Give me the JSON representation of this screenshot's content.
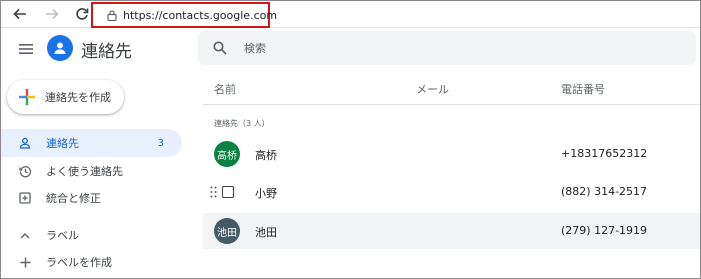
{
  "browser": {
    "url": "https://contacts.google.com",
    "icons": [
      "back-arrow-icon",
      "forward-arrow-icon",
      "reload-icon",
      "lock-icon"
    ]
  },
  "app": {
    "title": "連絡先",
    "search_placeholder": "検索",
    "create_label": "連絡先を作成"
  },
  "sidebar": {
    "items": [
      {
        "label": "連絡先",
        "icon": "person-icon",
        "count": "3",
        "active": true
      },
      {
        "label": "よく使う連絡先",
        "icon": "history-icon"
      },
      {
        "label": "統合と修正",
        "icon": "merge-icon"
      },
      {
        "label": "ラベル",
        "icon": "chevron-up-icon"
      },
      {
        "label": "ラベルを作成",
        "icon": "plus-icon"
      }
    ]
  },
  "table": {
    "headers": {
      "name": "名前",
      "email": "メール",
      "phone": "電話番号"
    },
    "section_label": "連絡先（3 人）",
    "rows": [
      {
        "avatar_text": "高桥",
        "avatar_color": "#0b8043",
        "name": "高桥",
        "phone": "+18317652312"
      },
      {
        "avatar_text": "",
        "name": "小野",
        "phone": "(882) 314-2517"
      },
      {
        "avatar_text": "池田",
        "avatar_color": "#455a64",
        "name": "池田",
        "phone": "(279) 127-1919"
      }
    ]
  },
  "colors": {
    "accent": "#1a73e8",
    "url_highlight": "#d4141b",
    "active_nav_bg": "#e8f0fe"
  }
}
